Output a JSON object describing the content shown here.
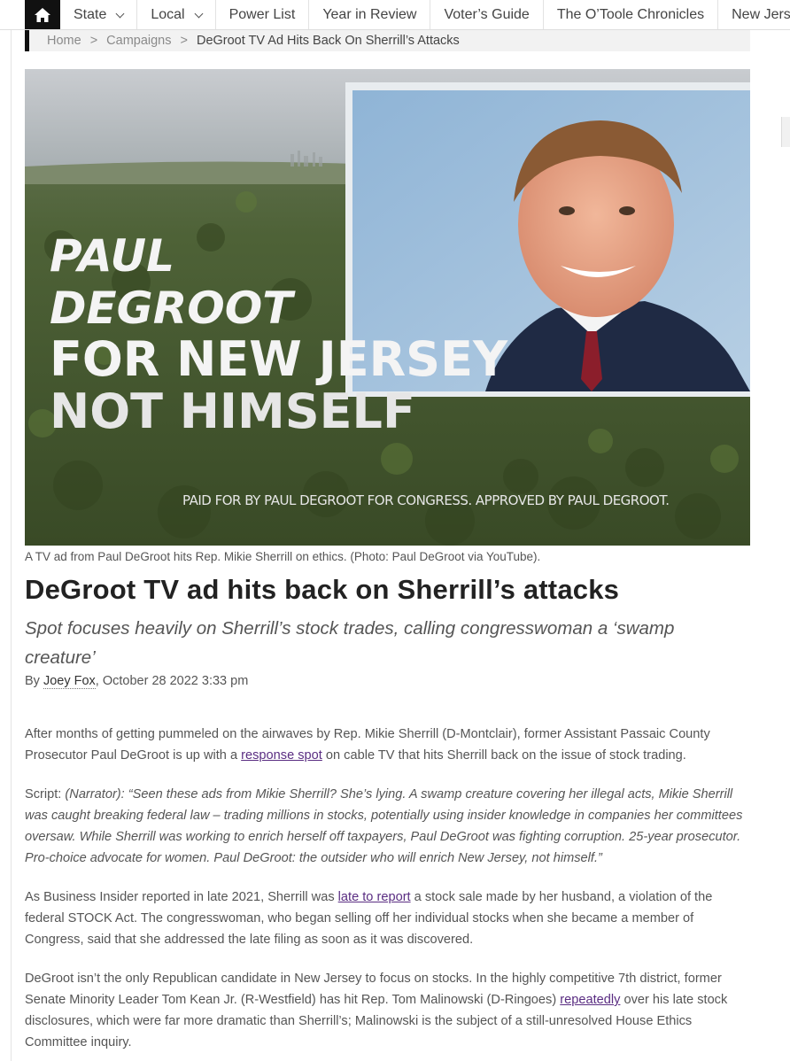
{
  "nav": {
    "home_icon": "home-icon",
    "items": [
      {
        "label": "State",
        "dropdown": true
      },
      {
        "label": "Local",
        "dropdown": true
      },
      {
        "label": "Power List",
        "dropdown": false
      },
      {
        "label": "Year in Review",
        "dropdown": false
      },
      {
        "label": "Voter’s Guide",
        "dropdown": false
      },
      {
        "label": "The O’Toole Chronicles",
        "dropdown": false
      },
      {
        "label": "New Jersey",
        "dropdown": false
      }
    ]
  },
  "breadcrumb": {
    "home": "Home",
    "separator": ">",
    "section": "Campaigns",
    "current": "DeGroot TV Ad Hits Back On Sherrill’s Attacks"
  },
  "hero": {
    "text_line1": "PAUL",
    "text_line2": "DEGROOT",
    "text_line3": "FOR NEW JERSEY",
    "text_line4": "NOT HIMSELF",
    "disclaimer": "PAID FOR BY PAUL DEGROOT FOR CONGRESS. APPROVED BY PAUL DEGROOT."
  },
  "article": {
    "caption": "A TV ad from Paul DeGroot hits Rep. Mikie Sherrill on ethics. (Photo: Paul DeGroot via YouTube).",
    "headline": "DeGroot TV ad hits back on Sherrill’s attacks",
    "subhead": "Spot focuses heavily on Sherrill’s stock trades, calling congresswoman a ‘swamp creature’",
    "byline_prefix": "By ",
    "author": "Joey Fox",
    "date": ", October 28 2022 3:33 pm",
    "p1_a": "After months of getting pummeled on the airwaves by Rep. Mikie Sherrill (D-Montclair), former Assistant Passaic County Prosecutor Paul DeGroot is up with a ",
    "p1_link": "response spot",
    "p1_b": " on cable TV that hits Sherrill back on the issue of stock trading.",
    "p2_label": "Script: ",
    "p2_text": "(Narrator): “Seen these ads from Mikie Sherrill? She’s lying. A swamp creature covering her illegal acts, Mikie Sherrill was caught breaking federal law – trading millions in stocks, potentially using insider knowledge in companies her committees oversaw. While Sherrill was working to enrich herself off taxpayers, Paul DeGroot was fighting corruption. 25-year prosecutor. Pro-choice advocate for women. Paul DeGroot: the outsider who will enrich New Jersey, not himself.”",
    "p3_a": "As Business Insider reported in late 2021, Sherrill was ",
    "p3_link": "late to report",
    "p3_b": " a stock sale made by her husband, a violation of the federal STOCK Act. The congresswoman, who began selling off her individual stocks when she became a member of Congress, said that she addressed the late filing as soon as it was discovered.",
    "p4_a": "DeGroot isn’t the only Republican candidate in New Jersey to focus on stocks. In the highly competitive 7th district, former Senate Minority Leader Tom Kean Jr. (R-Westfield) has hit Rep. Tom Malinowski (D-Ringoes) ",
    "p4_link": "repeatedly",
    "p4_b": " over his late stock disclosures, which were far more dramatic than Sherrill’s; Malinowski is the subject of a still-unresolved House Ethics Committee inquiry."
  }
}
